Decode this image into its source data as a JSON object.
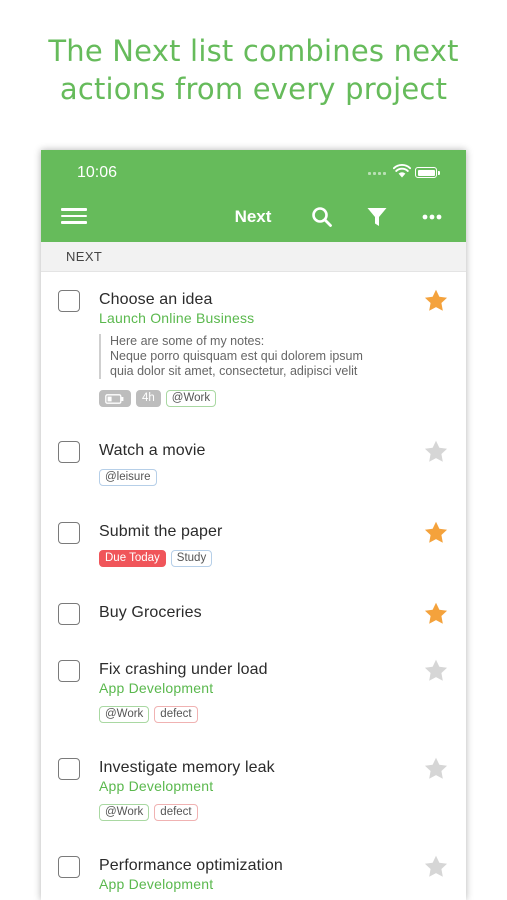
{
  "headline": {
    "line1": "The Next list combines next",
    "line2": "actions from every project"
  },
  "status_bar": {
    "time": "10:06"
  },
  "app_bar": {
    "title": "Next",
    "icons": [
      "menu-icon",
      "search-icon",
      "filter-icon",
      "more-icon"
    ]
  },
  "section": {
    "label": "NEXT"
  },
  "colors": {
    "accent": "#66bb5b",
    "project_text": "#5ab84d",
    "star_active": "#f4a23c",
    "star_inactive": "#d6d6d6",
    "due_badge": "#f0555a"
  },
  "tasks": [
    {
      "title": "Choose an idea",
      "project": "Launch Online Business",
      "starred": true,
      "notes": [
        "Here are some of my notes:",
        "Neque porro quisquam est qui dolorem ipsum",
        "quia dolor sit amet, consectetur, adipisci velit"
      ],
      "tags": [
        "battery-icon",
        "4h",
        "@Work"
      ]
    },
    {
      "title": "Watch a movie",
      "starred": false,
      "tags": [
        "@leisure"
      ]
    },
    {
      "title": "Submit the paper",
      "starred": true,
      "tags": [
        "Due Today",
        "Study"
      ]
    },
    {
      "title": "Buy Groceries",
      "starred": true
    },
    {
      "title": "Fix crashing under load",
      "project": "App Development",
      "starred": false,
      "tags": [
        "@Work",
        "defect"
      ]
    },
    {
      "title": "Investigate memory leak",
      "project": "App Development",
      "starred": false,
      "tags": [
        "@Work",
        "defect"
      ]
    },
    {
      "title": "Performance optimization",
      "project": "App Development",
      "starred": false
    }
  ]
}
